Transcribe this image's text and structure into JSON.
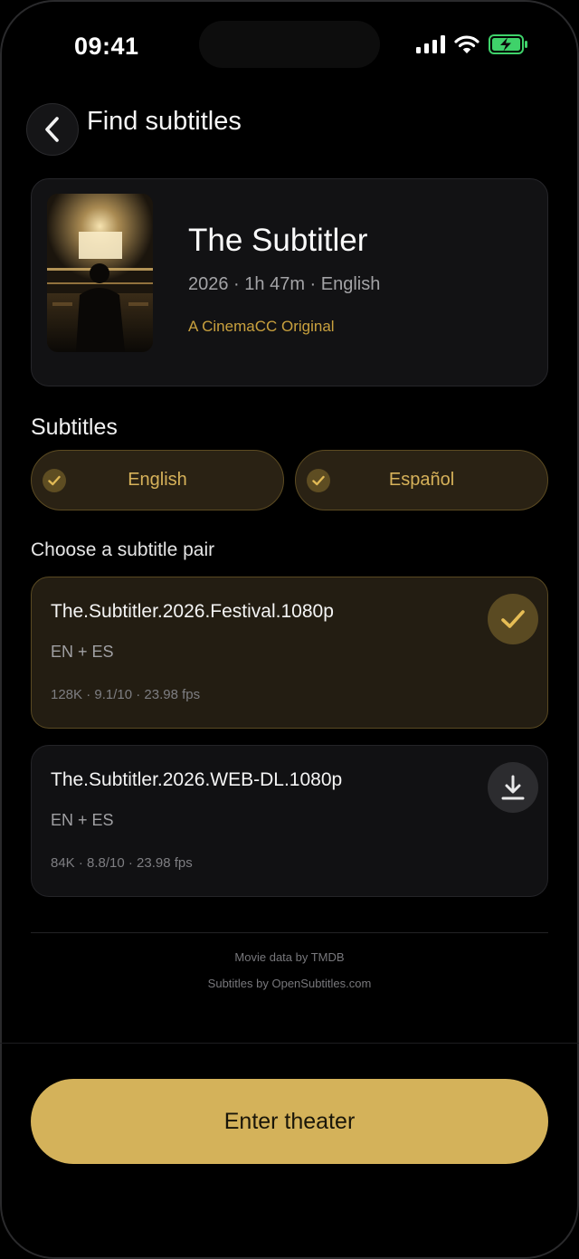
{
  "status": {
    "time": "09:41",
    "icons": [
      "signal-icon",
      "wifi-icon",
      "battery-charging-icon"
    ],
    "battery_color": "#3fd26a"
  },
  "header": {
    "back_icon": "chevron-left-icon",
    "title": "Find subtitles"
  },
  "movie": {
    "title": "The Subtitler",
    "meta": "2026 · 1h 47m · English",
    "tagline": "A CinemaCC Original",
    "poster_icon": "poster-image"
  },
  "subtitles": {
    "section_title": "Subtitles",
    "languages": [
      {
        "label": "English",
        "selected": true
      },
      {
        "label": "Español",
        "selected": true
      }
    ]
  },
  "pairs": {
    "section_title": "Choose a subtitle pair",
    "items": [
      {
        "name": "The.Subtitler.2026.Festival.1080p",
        "langs": "EN + ES",
        "stats": "128K · 9.1/10 · 23.98 fps",
        "selected": true,
        "action_icon": "check-icon"
      },
      {
        "name": "The.Subtitler.2026.WEB-DL.1080p",
        "langs": "EN + ES",
        "stats": "84K · 8.8/10 · 23.98 fps",
        "selected": false,
        "action_icon": "download-icon"
      }
    ]
  },
  "credits": {
    "movie_data": "Movie data by TMDB",
    "subtitles": "Subtitles by OpenSubtitles.com"
  },
  "cta": {
    "label": "Enter theater"
  },
  "colors": {
    "accent": "#d4b25a",
    "accent_text": "#c9a13e",
    "background": "#000000",
    "card": "#121214"
  }
}
